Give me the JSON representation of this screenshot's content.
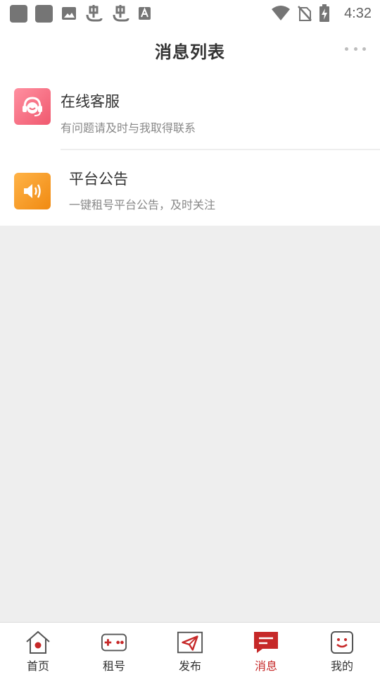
{
  "status_bar": {
    "time": "4:32",
    "left_icons": [
      "notification-square-icon",
      "notification-square-icon",
      "image-icon",
      "bug-icon",
      "bug-icon",
      "font-icon"
    ],
    "right_icons": [
      "wifi-icon",
      "no-sim-icon",
      "battery-charging-icon"
    ]
  },
  "header": {
    "title": "消息列表",
    "more_icon": "more-dots-icon"
  },
  "messages": [
    {
      "title": "在线客服",
      "subtitle": "有问题请及时与我取得联系",
      "icon": "customer-service-icon",
      "color": "#f26b7d"
    },
    {
      "title": "平台公告",
      "subtitle": "一键租号平台公告，及时关注",
      "icon": "speaker-icon",
      "color": "#f39a26"
    }
  ],
  "bottom_nav": {
    "items": [
      {
        "label": "首页",
        "icon": "home-icon",
        "active": false
      },
      {
        "label": "租号",
        "icon": "gamepad-icon",
        "active": false
      },
      {
        "label": "发布",
        "icon": "send-icon",
        "active": false
      },
      {
        "label": "消息",
        "icon": "message-icon",
        "active": true
      },
      {
        "label": "我的",
        "icon": "smiley-icon",
        "active": false
      }
    ]
  },
  "colors": {
    "accent": "#c62828",
    "background": "#eeeeee"
  }
}
